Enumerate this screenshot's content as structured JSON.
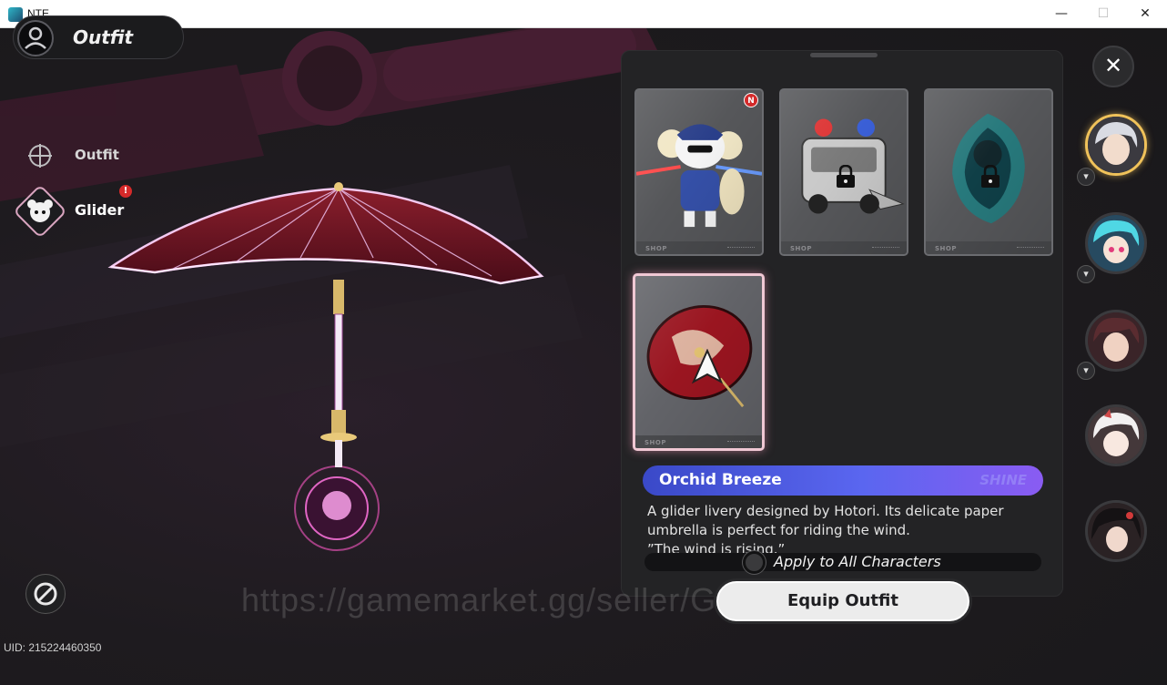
{
  "window": {
    "title": "NTE",
    "minimize_glyph": "—",
    "maximize_glyph": "☐",
    "close_glyph": "✕"
  },
  "header": {
    "title": "Outfit",
    "icon": "character-silhouette-icon"
  },
  "nav": {
    "items": [
      {
        "label": "Outfit",
        "icon": "crosshair-globe-icon"
      },
      {
        "label": "Glider",
        "icon": "glider-mascot-icon",
        "alert": "!"
      }
    ]
  },
  "footer": {
    "uid": "UID: 215224460350",
    "hide_ui_icon": "prohibit-icon"
  },
  "cards": [
    {
      "name": "police-mascot-glider",
      "badge": "N",
      "locked": false,
      "footer": "SHOP"
    },
    {
      "name": "police-car-glider",
      "locked": true,
      "footer": "SHOP"
    },
    {
      "name": "spirit-flame-glider",
      "locked": true,
      "footer": "SHOP"
    },
    {
      "name": "orchid-umbrella-glider",
      "selected": true,
      "locked": false,
      "footer": "SHOP"
    }
  ],
  "selected_item": {
    "name": "Orchid Breeze",
    "tag": "SHINE",
    "description_lines": [
      "A glider livery designed by Hotori. Its delicate paper",
      "umbrella is perfect for riding the wind.",
      "”The wind is rising.”"
    ]
  },
  "apply_all_label": "Apply to All Characters",
  "equip_button": "Equip Outfit",
  "watermark": "https://gamemarket.gg/seller/G",
  "close_glyph": "✕",
  "characters": [
    {
      "name": "silver-haired-character",
      "active": true
    },
    {
      "name": "teal-haired-character",
      "swap": true
    },
    {
      "name": "dark-haired-character",
      "swap": true
    },
    {
      "name": "white-haired-character"
    },
    {
      "name": "black-haired-character"
    }
  ],
  "colors": {
    "accent_pink": "#f0c8d4",
    "name_bar_start": "#3a49c8",
    "name_bar_end": "#8a5cf2",
    "active_avatar_ring": "#f0c25a",
    "alert_red": "#d52a2a"
  }
}
